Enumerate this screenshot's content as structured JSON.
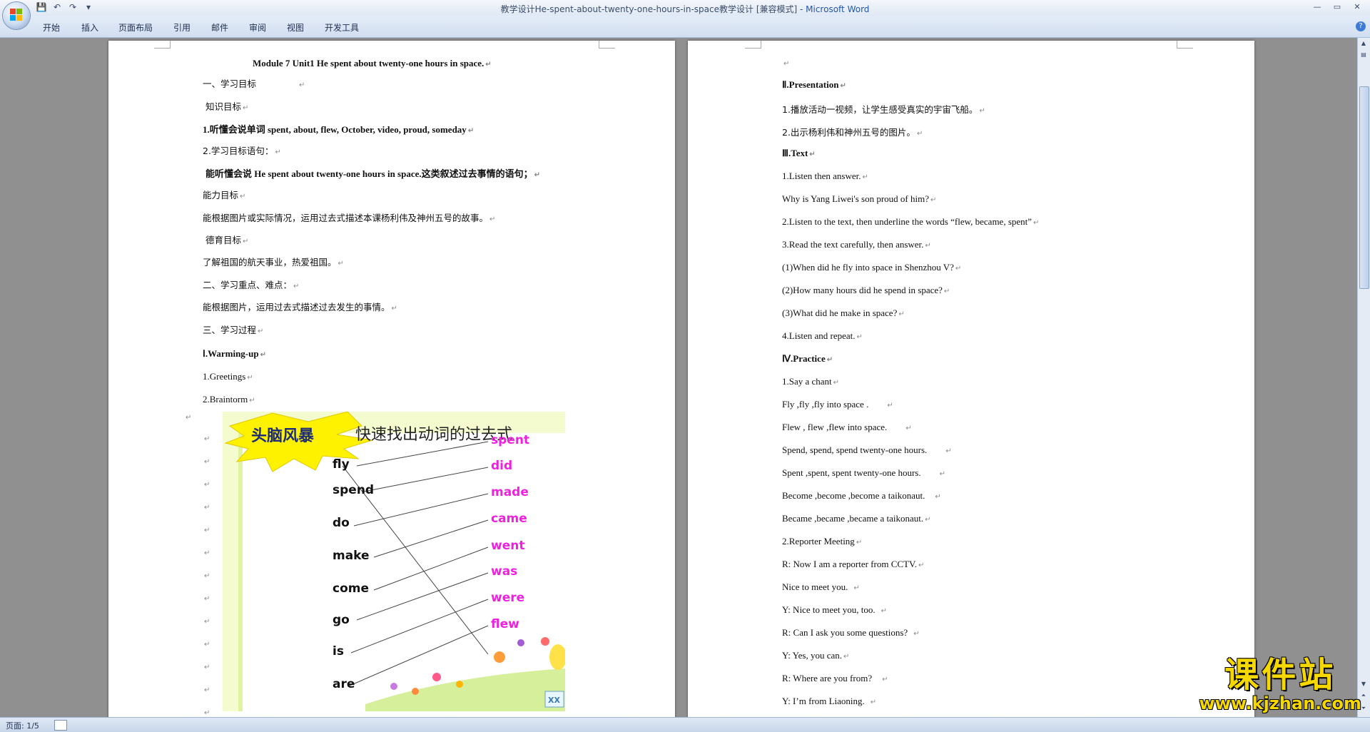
{
  "titlebar": {
    "doc_title": "教学设计He-spent-about-twenty-one-hours-in-space教学设计 [兼容模式] - ",
    "app_name": "Microsoft Word"
  },
  "ribbon_tabs": [
    "开始",
    "插入",
    "页面布局",
    "引用",
    "邮件",
    "审阅",
    "视图",
    "开发工具"
  ],
  "left_page": {
    "heading": "Module 7 Unit1 He spent about twenty-one hours in space.",
    "lines": [
      "一、学习目标",
      "知识目标",
      "1.听懂会说单词 spent, about, flew, October, video,    proud, someday",
      "2.学习目标语句：",
      "能听懂会说  He spent about twenty-one hours in space.这类叙述过去事情的语句；",
      "能力目标",
      "能根据图片或实际情况，运用过去式描述本课杨利伟及神州五号的故事。",
      "德育目标",
      "了解祖国的航天事业，热爱祖国。",
      "二、学习重点、难点：",
      "能根据图片，运用过去式描述过去发生的事情。",
      "三、学习过程",
      "Ⅰ.Warming-up",
      "1.Greetings",
      "2.Braintorm"
    ],
    "brainstorm": {
      "star_label": "头脑风暴",
      "caption": "快速找出动词的过去式",
      "verbs": [
        "fly",
        "spend",
        "do",
        "make",
        "come",
        "go",
        "is",
        "are"
      ],
      "past_forms": [
        "spent",
        "did",
        "made",
        "came",
        "went",
        "was",
        "were",
        "flew"
      ],
      "corner_label": "XX"
    }
  },
  "right_page": {
    "lines": [
      "Ⅱ.Presentation",
      "1.播放活动一视频，让学生感受真实的宇宙飞船。",
      "2.出示杨利伟和神州五号的图片。",
      "Ⅲ.Text",
      "1.Listen then answer.",
      "Why is Yang Liwei's  son proud of him?",
      "2.Listen to the text, then underline the words “flew, became, spent”",
      "3.Read the text carefully, then answer.",
      "(1)When did he fly into space in Shenzhou V?",
      "(2)How many hours did he spend  in space?",
      "(3)What did he make  in space?",
      "4.Listen and repeat.",
      "Ⅳ.Practice",
      "1.Say a chant",
      "Fly ,fly ,fly into space .",
      "Flew , flew ,flew into space.",
      "Spend, spend, spend twenty-one hours.",
      "Spent ,spent, spent twenty-one hours.",
      "Become ,become ,become a taikonaut.",
      "Became ,became ,became a taikonaut.",
      "2.Reporter Meeting",
      "R: Now I am a reporter from CCTV.",
      "  Nice to meet you.",
      "Y: Nice to meet you, too.",
      "R: Can I ask you some questions?",
      "Y: Yes, you can.",
      "R: Where are you from?",
      "Y: I’m from Liaoning."
    ]
  },
  "status": {
    "page_info": "页面: 1/5"
  },
  "watermark": {
    "title": "课件站",
    "url": "www.kjzhan.com"
  },
  "colors": {
    "verb_past": "#ee22dd",
    "watermark": "#f5d800",
    "title_app": "#2356a8"
  }
}
